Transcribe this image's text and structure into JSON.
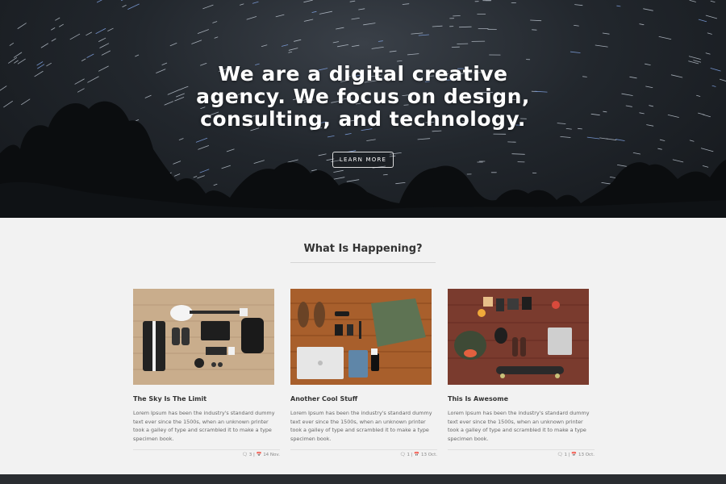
{
  "hero": {
    "title": "We are a digital creative agency. We focus on design, consulting, and technology.",
    "button_label": "LEARN MORE"
  },
  "section": {
    "title": "What Is Happening?"
  },
  "posts": [
    {
      "title": "The Sky Is The Limit",
      "text": "Lorem Ipsum has been the industry's standard dummy text ever since the 1500s, when an unknown printer took a galley of type and scrambled it to make a type specimen book.",
      "comments": "3",
      "date": "14 Nov."
    },
    {
      "title": "Another Cool Stuff",
      "text": "Lorem Ipsum has been the industry's standard dummy text ever since the 1500s, when an unknown printer took a galley of type and scrambled it to make a type specimen book.",
      "comments": "1",
      "date": "13 Oct."
    },
    {
      "title": "This Is Awesome",
      "text": "Lorem Ipsum has been the industry's standard dummy text ever since the 1500s, when an unknown printer took a galley of type and scrambled it to make a type specimen book.",
      "comments": "1",
      "date": "13 Oct."
    }
  ],
  "icons": {
    "comment": "comment-icon",
    "calendar": "calendar-icon"
  },
  "colors": {
    "hero_bg": "#22272d",
    "section_bg": "#f2f2f2",
    "title_text": "#333333",
    "body_text": "#666666"
  }
}
